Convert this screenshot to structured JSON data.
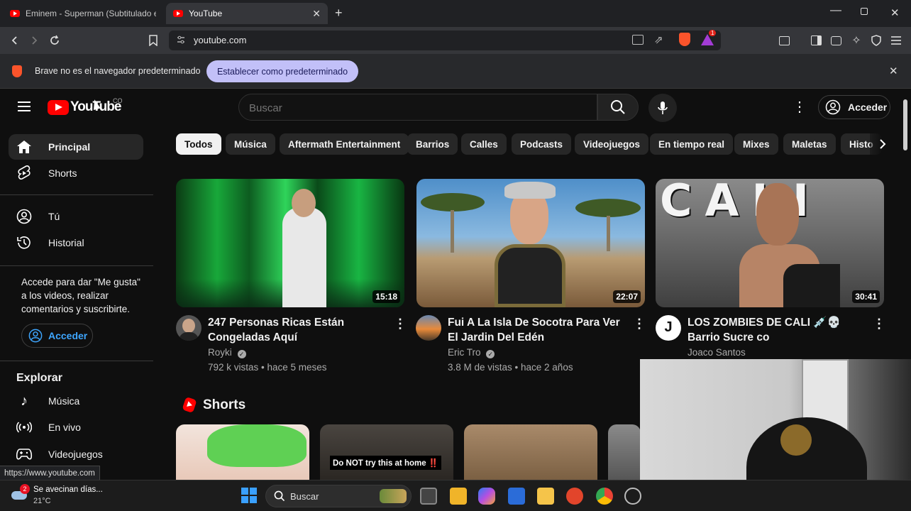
{
  "browser": {
    "tabs": [
      {
        "title": "Eminem - Superman (Subtitulado en"
      },
      {
        "title": "YouTube"
      }
    ],
    "new_tab_icon": "plus-icon",
    "address": "youtube.com",
    "shield_count": "",
    "notif_badge": "1",
    "infobar": {
      "message": "Brave no es el navegador predeterminado",
      "button": "Establecer como predeterminado"
    },
    "status_url": "https://www.youtube.com"
  },
  "youtube": {
    "logo_text": "YouTube",
    "country": "CO",
    "search_placeholder": "Buscar",
    "signin_label": "Acceder",
    "sidebar": {
      "top": [
        {
          "label": "Principal",
          "icon": "home-icon"
        },
        {
          "label": "Shorts",
          "icon": "shorts-icon"
        }
      ],
      "you": [
        {
          "label": "Tú",
          "icon": "user-icon"
        },
        {
          "label": "Historial",
          "icon": "history-icon"
        }
      ],
      "signin_prompt": "Accede para dar \"Me gusta\" a los videos, realizar comentarios y suscribirte.",
      "signin_button": "Acceder",
      "explore_heading": "Explorar",
      "explore": [
        {
          "label": "Música",
          "icon": "music-icon"
        },
        {
          "label": "En vivo",
          "icon": "live-icon"
        },
        {
          "label": "Videojuegos",
          "icon": "gaming-icon"
        }
      ]
    },
    "chips": [
      "Todos",
      "Música",
      "Aftermath Entertainment",
      "Barrios",
      "Calles",
      "Podcasts",
      "Videojuegos",
      "En tiempo real",
      "Mixes",
      "Maletas",
      "Histo"
    ],
    "videos": [
      {
        "title": "247 Personas Ricas Están Congeladas Aquí",
        "channel": "Royki",
        "meta": "792 k vistas • hace 5 meses",
        "duration": "15:18"
      },
      {
        "title": "Fui A La Isla De Socotra Para Ver El Jardin Del Edén",
        "channel": "Eric Tro",
        "meta": "3.8 M de vistas • hace 2 años",
        "duration": "22:07"
      },
      {
        "title": "LOS ZOMBIES DE CALI 💉💀Barrio Sucre co",
        "channel": "Joaco Santos",
        "meta": "",
        "duration": "30:41",
        "avatar_letter": "J",
        "thumb_text": "CALI"
      }
    ],
    "shorts_heading": "Shorts",
    "shorts": [
      {
        "overlay": ""
      },
      {
        "overlay": "Do NOT try this at home ‼️"
      },
      {
        "overlay": ""
      },
      {
        "overlay": ""
      }
    ]
  },
  "taskbar": {
    "weather_text": "Se avecinan días...",
    "weather_temp": "21°C",
    "weather_badge": "2",
    "search_label": "Buscar"
  },
  "colors": {
    "accent_red": "#ff0000",
    "infobar_button_bg": "#c2c0f8",
    "link_blue": "#3ea6ff"
  }
}
